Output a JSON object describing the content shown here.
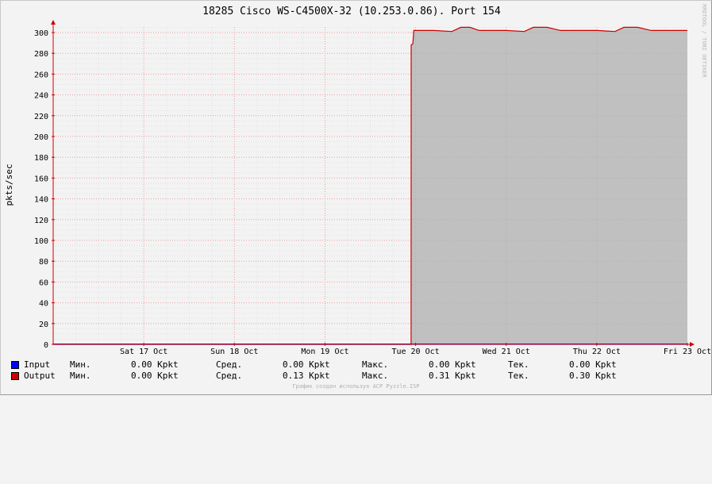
{
  "chart_data": {
    "type": "area",
    "title": "18285 Cisco WS-C4500X-32 (10.253.0.86). Port 154",
    "xlabel": "",
    "ylabel": "pkts/sec",
    "ylim": [
      0,
      310
    ],
    "y_ticks": [
      0,
      20,
      40,
      60,
      80,
      100,
      120,
      140,
      160,
      180,
      200,
      220,
      240,
      260,
      280,
      300
    ],
    "x_range_days": [
      "Fri 16 Oct",
      "Fri 23 Oct"
    ],
    "x_ticks": [
      "Sat 17 Oct",
      "Sun 18 Oct",
      "Mon 19 Oct",
      "Tue 20 Oct",
      "Wed 21 Oct",
      "Thu 22 Oct",
      "Fri 23 Oct"
    ],
    "grid": true,
    "legend_position": "bottom-left",
    "series": [
      {
        "name": "Input",
        "color": "#0000ff",
        "x": [
          0.0,
          7.0
        ],
        "values": [
          0,
          0
        ]
      },
      {
        "name": "Output",
        "color": "#cc0000",
        "fill": "#c0c0c0",
        "x": [
          0.0,
          3.95,
          3.951,
          3.97,
          3.98,
          4.2,
          4.4,
          4.5,
          4.6,
          4.7,
          4.85,
          5.0,
          5.2,
          5.3,
          5.45,
          5.6,
          5.75,
          6.0,
          6.2,
          6.3,
          6.45,
          6.6,
          6.75,
          6.9,
          7.0
        ],
        "values": [
          0,
          0,
          288,
          289,
          302,
          302,
          301,
          305,
          305,
          302,
          302,
          302,
          301,
          305,
          305,
          302,
          302,
          302,
          301,
          305,
          305,
          302,
          302,
          302,
          302
        ]
      }
    ]
  },
  "legend": {
    "rows": [
      {
        "label": "Input",
        "color": "#0000ff",
        "min_label": "Мин.",
        "min": "0.00 Kpkt",
        "avg_label": "Сред.",
        "avg": "0.00 Kpkt",
        "max_label": "Макс.",
        "max": "0.00 Kpkt",
        "cur_label": "Тек.",
        "cur": "0.00 Kpkt"
      },
      {
        "label": "Output",
        "color": "#cc0000",
        "min_label": "Мин.",
        "min": "0.00 Kpkt",
        "avg_label": "Сред.",
        "avg": "0.13 Kpkt",
        "max_label": "Макс.",
        "max": "0.31 Kpkt",
        "cur_label": "Тек.",
        "cur": "0.30 Kpkt"
      }
    ]
  },
  "side_label": "RRDTOOL / TOBI OETIKER",
  "footer": "График создан используя ACP Pyzzle.ISP"
}
